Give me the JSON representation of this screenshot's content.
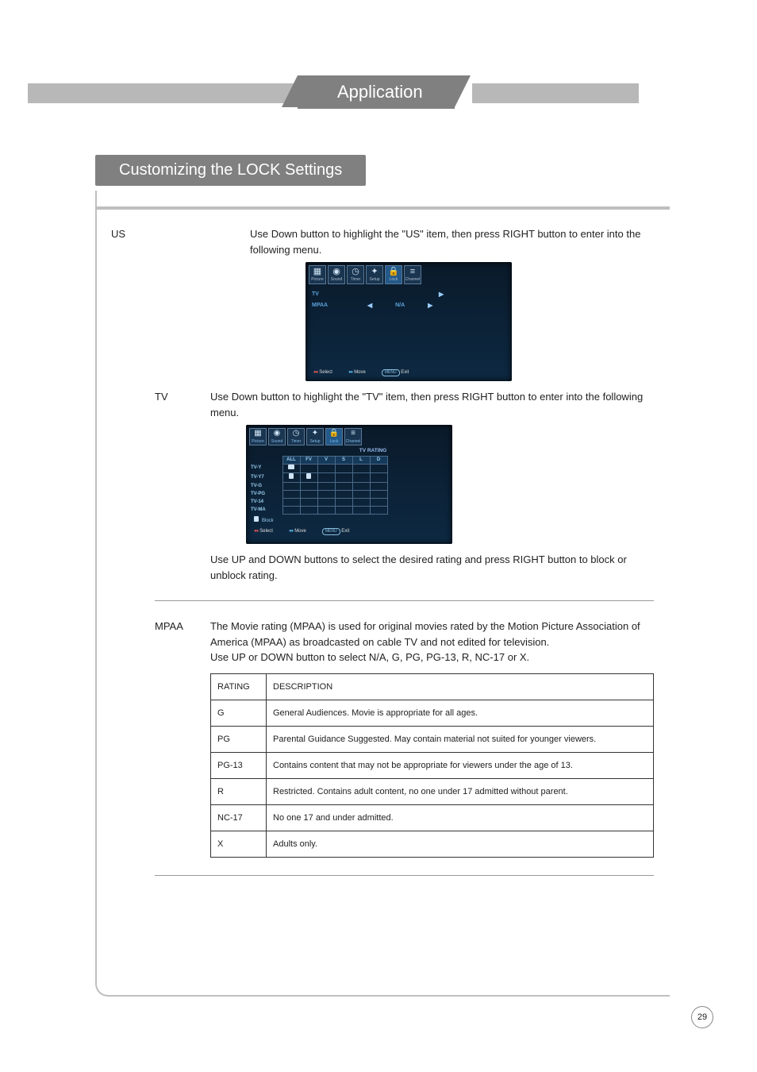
{
  "header": {
    "app_title": "Application",
    "section_title": "Customizing the LOCK Settings"
  },
  "page_number": "29",
  "us": {
    "label": "US",
    "intro": "Use Down button to highlight the \"US\" item, then press RIGHT button to enter into the following menu.",
    "osd": {
      "tabs": [
        "Picture",
        "Sound",
        "Timer",
        "Setup",
        "Lock",
        "Channel"
      ],
      "rows": [
        {
          "label": "TV",
          "value": "",
          "arrow_right": "▶"
        },
        {
          "label": "MPAA",
          "left": "◀",
          "value": "N/A",
          "right": "▶"
        }
      ],
      "footer": {
        "select": "Select",
        "move": "Move",
        "exit": "Exit",
        "exit_btn": "MENU"
      }
    }
  },
  "tv": {
    "label": "TV",
    "intro": "Use Down button to highlight the \"TV\" item, then press RIGHT button to enter into the following menu.",
    "osd": {
      "tabs": [
        "Picture",
        "Sound",
        "Timer",
        "Setup",
        "Lock",
        "Channel"
      ],
      "title": "TV    RATING",
      "col_headers": [
        "ALL",
        "FV",
        "V",
        "S",
        "L",
        "D"
      ],
      "rows": [
        "TV-Y",
        "TV-Y7",
        "TV-G",
        "TV-PG",
        "TV-14",
        "TV-MA"
      ],
      "legend": "Block",
      "footer": {
        "select": "Select",
        "move": "Move",
        "exit": "Exit",
        "exit_btn": "MENU"
      }
    },
    "outro": "Use UP and DOWN buttons to select the desired rating and press RIGHT button to block or unblock rating."
  },
  "mpaa": {
    "label": "MPAA",
    "desc": "The Movie rating (MPAA) is used for original movies rated by the Motion Picture Association of America (MPAA) as broadcasted on cable TV and not edited for television.",
    "desc2": "Use UP or DOWN button to select N/A, G, PG, PG-13, R, NC-17 or X.",
    "table": {
      "h1": "RATING",
      "h2": "DESCRIPTION",
      "rows": [
        {
          "r": "G",
          "d": "General Audiences. Movie is appropriate for all ages."
        },
        {
          "r": "PG",
          "d": "Parental Guidance Suggested. May contain material not suited for younger viewers."
        },
        {
          "r": "PG-13",
          "d": "Contains content that may not be appropriate for viewers under the age of 13."
        },
        {
          "r": "R",
          "d": "Restricted. Contains adult content, no one under 17 admitted without parent."
        },
        {
          "r": "NC-17",
          "d": "No one 17 and under admitted."
        },
        {
          "r": "X",
          "d": "Adults only."
        }
      ]
    }
  }
}
